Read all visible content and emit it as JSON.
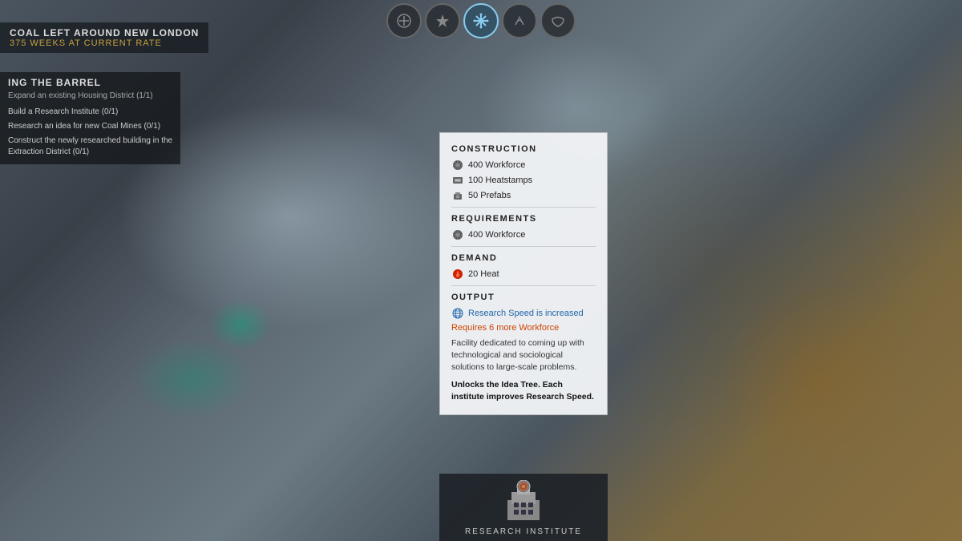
{
  "map": {
    "bg_description": "snowy terrain map of New London"
  },
  "top_nav": {
    "buttons": [
      {
        "id": "btn1",
        "icon": "⬡",
        "label": "hexagon-nav",
        "active": false
      },
      {
        "id": "btn2",
        "icon": "✦",
        "label": "star-nav",
        "active": false
      },
      {
        "id": "btn3",
        "icon": "❄",
        "label": "snowflake-nav",
        "active": true
      },
      {
        "id": "btn4",
        "icon": "↗",
        "label": "arrow-nav",
        "active": false
      },
      {
        "id": "btn5",
        "icon": "⬡",
        "label": "cloud-nav",
        "active": false
      }
    ]
  },
  "top_left": {
    "coal_label": "COAL LEFT AROUND NEW LONDON",
    "rate_label": "375 WEEKS AT CURRENT RATE"
  },
  "tasks_panel": {
    "title": "ING THE BARREL",
    "subtitle": "Expand an existing Housing District (1/1)",
    "items": [
      "Build a Research Institute (0/1)",
      "Research an idea for new Coal Mines (0/1)",
      "Construct the newly researched building in the\nExtraction District (0/1)"
    ]
  },
  "construction_panel": {
    "section_construction": "CONSTRUCTION",
    "workforce_1": "400 Workforce",
    "heatstamps": "100 Heatstamps",
    "prefabs": "50 Prefabs",
    "section_requirements": "REQUIREMENTS",
    "workforce_2": "400 Workforce",
    "section_demand": "DEMAND",
    "heat": "20 Heat",
    "section_output": "OUTPUT",
    "output_text": "Research Speed is increased",
    "warning": "Requires 6 more Workforce",
    "description": "Facility dedicated to coming up with technological and sociological solutions to large-scale problems.",
    "bold_note": "Unlocks the Idea Tree. Each institute improves Research Speed."
  },
  "building_footer": {
    "label": "RESEARCH INSTITUTE"
  },
  "icons": {
    "workforce_icon": "⚙",
    "heat_icon": "🔥",
    "output_icon": "🌐"
  }
}
